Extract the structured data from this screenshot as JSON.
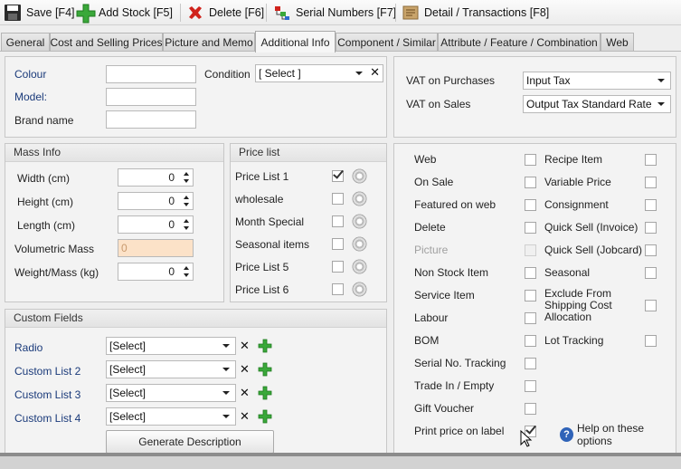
{
  "toolbar": {
    "save": "Save [F4]",
    "add_stock": "Add Stock [F5]",
    "delete": "Delete [F6]",
    "serial": "Serial Numbers [F7]",
    "detail": "Detail / Transactions [F8]"
  },
  "tabs": [
    "General",
    "Cost and Selling Prices",
    "Picture and Memo",
    "Additional Info",
    "Component / Similar",
    "Attribute / Feature / Combination",
    "Web"
  ],
  "active_tab": "Additional Info",
  "top": {
    "colour_label": "Colour",
    "model_label": "Model:",
    "brand_label": "Brand name",
    "colour_value": "",
    "model_value": "",
    "brand_value": "",
    "condition_label": "Condition",
    "condition_value": "[ Select ]"
  },
  "vat": {
    "purchases_label": "VAT on Purchases",
    "purchases_value": "Input Tax",
    "sales_label": "VAT on Sales",
    "sales_value": "Output Tax Standard Rate"
  },
  "mass": {
    "title": "Mass Info",
    "width_label": "Width (cm)",
    "width": "0",
    "height_label": "Height (cm)",
    "height": "0",
    "length_label": "Length (cm)",
    "length": "0",
    "vol_label": "Volumetric Mass",
    "vol": "0",
    "weight_label": "Weight/Mass (kg)",
    "weight": "0"
  },
  "pricelist": {
    "title": "Price list",
    "items": [
      {
        "label": "Price List 1",
        "checked": true
      },
      {
        "label": "wholesale",
        "checked": false
      },
      {
        "label": "Month Special",
        "checked": false
      },
      {
        "label": "Seasonal items",
        "checked": false
      },
      {
        "label": "Price List 5",
        "checked": false
      },
      {
        "label": "Price List 6",
        "checked": false
      }
    ]
  },
  "custom": {
    "title": "Custom Fields",
    "fields": [
      {
        "label": "Radio",
        "value": "[Select]"
      },
      {
        "label": "Custom List 2",
        "value": "[Select]"
      },
      {
        "label": "Custom List 3",
        "value": "[Select]"
      },
      {
        "label": "Custom List 4",
        "value": "[Select]"
      }
    ],
    "generate": "Generate Description"
  },
  "options": {
    "left": [
      {
        "label": "Web",
        "checked": false
      },
      {
        "label": "On Sale",
        "checked": false
      },
      {
        "label": "Featured on web",
        "checked": false
      },
      {
        "label": "Delete",
        "checked": false
      },
      {
        "label": "Picture",
        "checked": false,
        "disabled": true
      },
      {
        "label": "Non Stock Item",
        "checked": false
      },
      {
        "label": "Service Item",
        "checked": false
      },
      {
        "label": "Labour",
        "checked": false
      },
      {
        "label": "BOM",
        "checked": false
      },
      {
        "label": "Serial No. Tracking",
        "checked": false
      },
      {
        "label": "Trade In / Empty",
        "checked": false
      },
      {
        "label": "Gift Voucher",
        "checked": false
      },
      {
        "label": "Print price on label",
        "checked": true
      }
    ],
    "right": [
      {
        "label": "Recipe Item",
        "checked": false
      },
      {
        "label": "Variable Price",
        "checked": false
      },
      {
        "label": "Consignment",
        "checked": false
      },
      {
        "label": "Quick Sell (Invoice)",
        "checked": false
      },
      {
        "label": "Quick Sell (Jobcard)",
        "checked": false
      },
      {
        "label": "Seasonal",
        "checked": false
      },
      {
        "label": "Exclude From Shipping Cost Allocation",
        "checked": false
      },
      {
        "label": "Lot Tracking",
        "checked": false
      }
    ],
    "help": "Help on these options"
  }
}
